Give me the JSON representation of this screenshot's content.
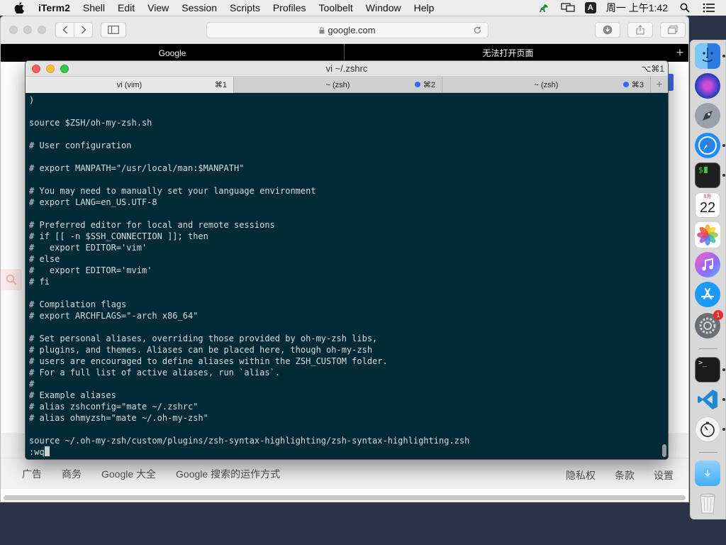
{
  "menubar": {
    "app_name": "iTerm2",
    "items": [
      "Shell",
      "Edit",
      "View",
      "Session",
      "Scripts",
      "Profiles",
      "Toolbelt",
      "Window",
      "Help"
    ],
    "input_method": "A",
    "clock": "周一 上午1:42"
  },
  "safari": {
    "url": "google.com",
    "tabs": [
      "Google",
      "无法打开页面"
    ],
    "footer_left": [
      "广告",
      "商务",
      "Google 大全",
      "Google 搜索的运作方式"
    ],
    "footer_right": [
      "隐私权",
      "条款",
      "设置"
    ]
  },
  "iterm": {
    "title": "vi ~/.zshrc",
    "title_shortcut": "⌥⌘1",
    "tabs": [
      {
        "label": "vi (vim)",
        "shortcut": "⌘1"
      },
      {
        "label": "~ (zsh)",
        "shortcut": "⌘2"
      },
      {
        "label": "~ (zsh)",
        "shortcut": "⌘3"
      }
    ],
    "lines": [
      ")",
      "",
      "source $ZSH/oh-my-zsh.sh",
      "",
      "# User configuration",
      "",
      "# export MANPATH=\"/usr/local/man:$MANPATH\"",
      "",
      "# You may need to manually set your language environment",
      "# export LANG=en_US.UTF-8",
      "",
      "# Preferred editor for local and remote sessions",
      "# if [[ -n $SSH_CONNECTION ]]; then",
      "#   export EDITOR='vim'",
      "# else",
      "#   export EDITOR='mvim'",
      "# fi",
      "",
      "# Compilation flags",
      "# export ARCHFLAGS=\"-arch x86_64\"",
      "",
      "# Set personal aliases, overriding those provided by oh-my-zsh libs,",
      "# plugins, and themes. Aliases can be placed here, though oh-my-zsh",
      "# users are encouraged to define aliases within the ZSH_CUSTOM folder.",
      "# For a full list of active aliases, run `alias`.",
      "#",
      "# Example aliases",
      "# alias zshconfig=\"mate ~/.zshrc\"",
      "# alias ohmyzsh=\"mate ~/.oh-my-zsh\"",
      "",
      "source ~/.oh-my-zsh/custom/plugins/zsh-syntax-highlighting/zsh-syntax-highlighting.zsh"
    ],
    "command_line": ":wq"
  },
  "dock": {
    "calendar_day": "22",
    "calendar_month": "8月",
    "notification_count": "1"
  }
}
